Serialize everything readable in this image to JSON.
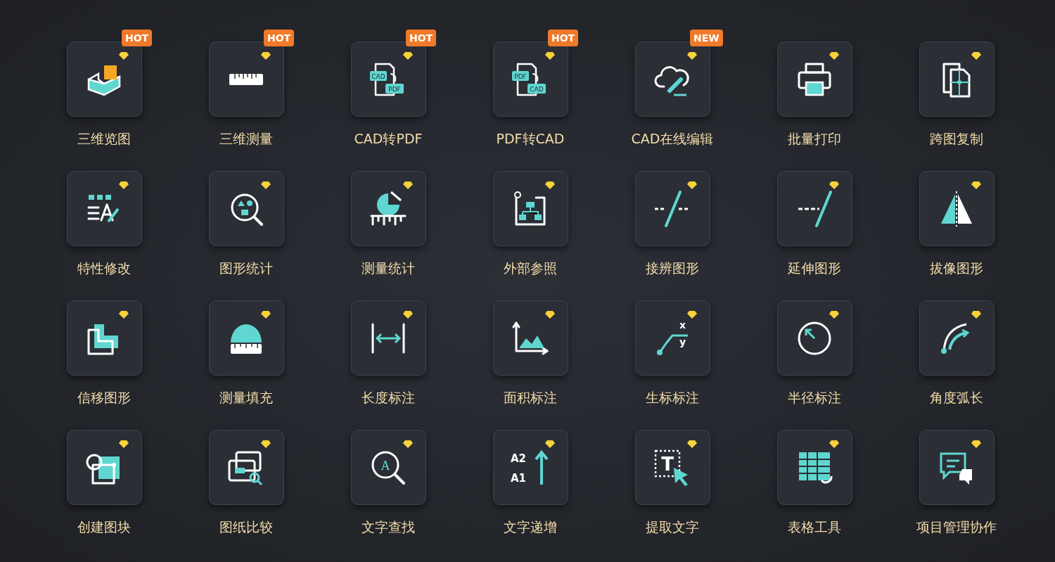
{
  "tools": [
    {
      "label": "三维览图",
      "badge": {
        "text": "HOT",
        "color": "#f07a2a"
      },
      "vip": true
    },
    {
      "label": "三维测量",
      "badge": {
        "text": "HOT",
        "color": "#f07a2a"
      },
      "vip": true
    },
    {
      "label": "CAD转PDF",
      "icon_text": [
        "CAD",
        "PDF"
      ],
      "badge": {
        "text": "HOT",
        "color": "#f07a2a"
      },
      "vip": true
    },
    {
      "label": "PDF转CAD",
      "icon_text": [
        "PDF",
        "CAD"
      ],
      "badge": {
        "text": "HOT",
        "color": "#f07a2a"
      },
      "vip": true
    },
    {
      "label": "CAD在线编辑",
      "badge": {
        "text": "NEW",
        "color": "#f07a2a"
      },
      "vip": true
    },
    {
      "label": "批量打印",
      "vip": true
    },
    {
      "label": "跨图复制",
      "vip": true
    },
    {
      "label": "特性修改",
      "vip": true
    },
    {
      "label": "图形统计",
      "vip": true
    },
    {
      "label": "测量统计",
      "vip": true
    },
    {
      "label": "外部参照",
      "vip": true
    },
    {
      "label": "接辨图形",
      "vip": true
    },
    {
      "label": "延伸图形",
      "vip": true
    },
    {
      "label": "拔像图形",
      "vip": true
    },
    {
      "label": "信移图形",
      "vip": true
    },
    {
      "label": "测量填充",
      "vip": true
    },
    {
      "label": "长度标注",
      "vip": true
    },
    {
      "label": "面积标注",
      "vip": true
    },
    {
      "label": "生标标注",
      "icon_text": [
        "x",
        "y"
      ],
      "vip": true
    },
    {
      "label": "半径标注",
      "vip": true
    },
    {
      "label": "角度弧长",
      "vip": true
    },
    {
      "label": "创建图块",
      "vip": true
    },
    {
      "label": "图纸比较",
      "vip": true
    },
    {
      "label": "文字查找",
      "icon_text": [
        "A"
      ],
      "vip": true
    },
    {
      "label": "文字递增",
      "icon_text": [
        "A2",
        "A1"
      ],
      "vip": true
    },
    {
      "label": "提取文字",
      "icon_text": [
        "T"
      ],
      "vip": true
    },
    {
      "label": "表格工具",
      "vip": true
    },
    {
      "label": "项目管理协作",
      "vip": true
    }
  ]
}
